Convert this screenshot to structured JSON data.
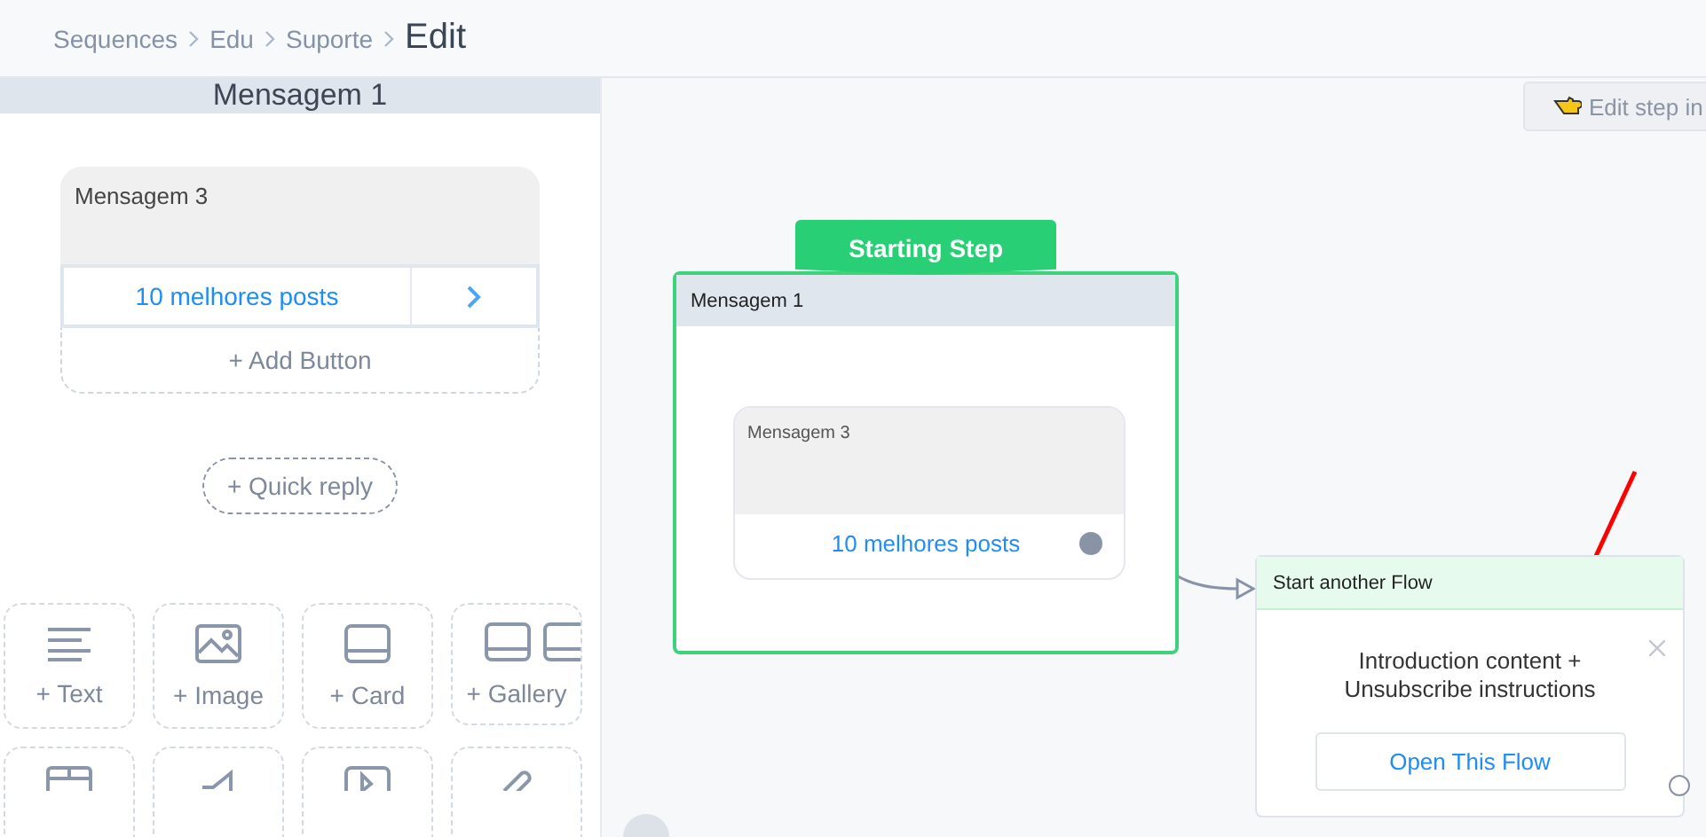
{
  "breadcrumb": [
    {
      "label": "Sequences",
      "selected": false
    },
    {
      "label": "Edu",
      "selected": false
    },
    {
      "label": "Suporte",
      "selected": false
    },
    {
      "label": "Edit",
      "selected": true
    }
  ],
  "sidebar": {
    "title": "Mensagem 1",
    "message": {
      "text": "Mensagem 3",
      "button": "10 melhores posts",
      "add_button": "+ Add Button"
    },
    "quick_reply": "+ Quick reply",
    "tiles": [
      {
        "kind": "text",
        "label": "+ Text"
      },
      {
        "kind": "image",
        "label": "+ Image"
      },
      {
        "kind": "card",
        "label": "+ Card"
      },
      {
        "kind": "gallery",
        "label": "+ Gallery"
      },
      {
        "kind": "list"
      },
      {
        "kind": "audio"
      },
      {
        "kind": "video"
      },
      {
        "kind": "file"
      }
    ]
  },
  "canvas": {
    "hint_button": "Edit step in",
    "start_badge": "Starting Step",
    "step": {
      "title": "Mensagem 1",
      "message": "Mensagem 3",
      "button": "10 melhores posts"
    },
    "flow_node": {
      "title": "Start another Flow",
      "description": "Introduction content + Unsubscribe instructions",
      "button": "Open This Flow"
    }
  }
}
